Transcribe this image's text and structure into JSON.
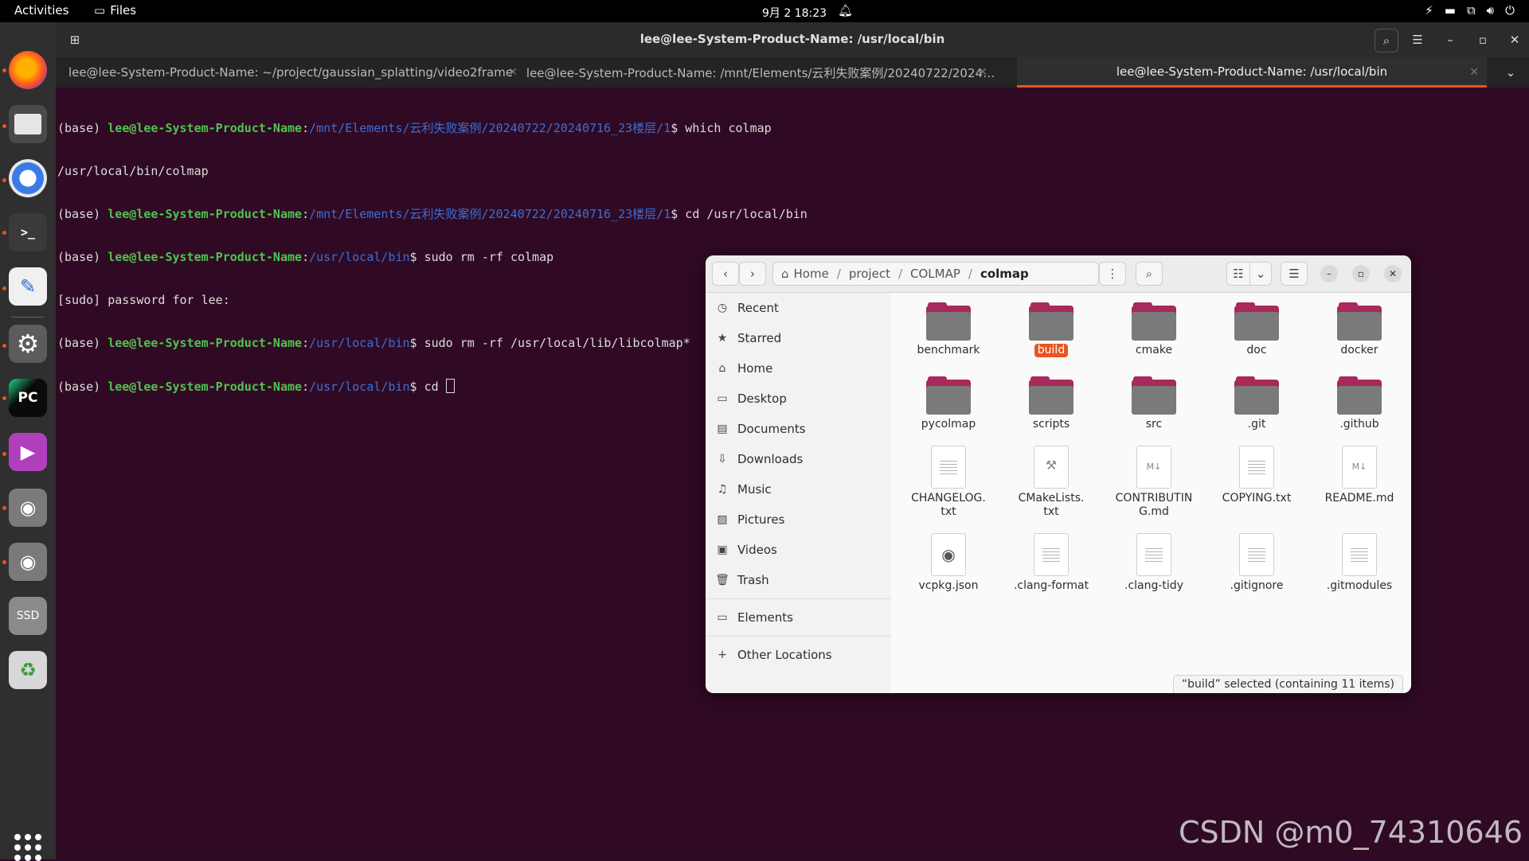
{
  "topbar": {
    "activities": "Activities",
    "app_name": "Files",
    "clock": "9月 2  18:23"
  },
  "terminal": {
    "title": "lee@lee-System-Product-Name: /usr/local/bin",
    "tabs": [
      {
        "label": "lee@lee-System-Product-Name: ~/project/gaussian_splatting/video2frame"
      },
      {
        "label": "lee@lee-System-Product-Name: /mnt/Elements/云利失败案例/20240722/2024…"
      },
      {
        "label": "lee@lee-System-Product-Name: /usr/local/bin"
      }
    ],
    "lines": [
      {
        "env": "(base) ",
        "user": "lee@lee-System-Product-Name",
        "colon": ":",
        "path": "/mnt/Elements/云利失败案例/20240722/20240716_23楼层/1",
        "cmd": "$ which colmap"
      },
      {
        "text": "/usr/local/bin/colmap"
      },
      {
        "env": "(base) ",
        "user": "lee@lee-System-Product-Name",
        "colon": ":",
        "path": "/mnt/Elements/云利失败案例/20240722/20240716_23楼层/1",
        "cmd": "$ cd /usr/local/bin"
      },
      {
        "env": "(base) ",
        "user": "lee@lee-System-Product-Name",
        "colon": ":",
        "path": "/usr/local/bin",
        "cmd": "$ sudo rm -rf colmap"
      },
      {
        "text": "[sudo] password for lee:"
      },
      {
        "env": "(base) ",
        "user": "lee@lee-System-Product-Name",
        "colon": ":",
        "path": "/usr/local/bin",
        "cmd": "$ sudo rm -rf /usr/local/lib/libcolmap*"
      },
      {
        "env": "(base) ",
        "user": "lee@lee-System-Product-Name",
        "colon": ":",
        "path": "/usr/local/bin",
        "cmd": "$ cd "
      }
    ]
  },
  "files": {
    "path": [
      "Home",
      "project",
      "COLMAP",
      "colmap"
    ],
    "sidebar": [
      {
        "label": "Recent",
        "icon": "clock-icon"
      },
      {
        "label": "Starred",
        "icon": "star-icon"
      },
      {
        "label": "Home",
        "icon": "home-icon"
      },
      {
        "label": "Desktop",
        "icon": "desktop-icon"
      },
      {
        "label": "Documents",
        "icon": "document-icon"
      },
      {
        "label": "Downloads",
        "icon": "download-icon"
      },
      {
        "label": "Music",
        "icon": "music-icon"
      },
      {
        "label": "Pictures",
        "icon": "picture-icon"
      },
      {
        "label": "Videos",
        "icon": "video-icon"
      },
      {
        "label": "Trash",
        "icon": "trash-icon"
      },
      {
        "label": "Elements",
        "icon": "folder-icon"
      },
      {
        "label": "Other Locations",
        "icon": "plus-icon"
      }
    ],
    "items": [
      {
        "name": "benchmark",
        "kind": "folder"
      },
      {
        "name": "build",
        "kind": "folder",
        "selected": true
      },
      {
        "name": "cmake",
        "kind": "folder"
      },
      {
        "name": "doc",
        "kind": "folder"
      },
      {
        "name": "docker",
        "kind": "folder"
      },
      {
        "name": "pycolmap",
        "kind": "folder"
      },
      {
        "name": "scripts",
        "kind": "folder"
      },
      {
        "name": "src",
        "kind": "folder"
      },
      {
        "name": ".git",
        "kind": "folder"
      },
      {
        "name": ".github",
        "kind": "folder"
      },
      {
        "name": "CHANGELOG.\ntxt",
        "kind": "text"
      },
      {
        "name": "CMakeLists.\ntxt",
        "kind": "cmake"
      },
      {
        "name": "CONTRIBUTIN\nG.md",
        "kind": "markdown"
      },
      {
        "name": "COPYING.txt",
        "kind": "text"
      },
      {
        "name": "README.md",
        "kind": "markdown"
      },
      {
        "name": "vcpkg.json",
        "kind": "json"
      },
      {
        "name": ".clang-format",
        "kind": "text"
      },
      {
        "name": ".clang-tidy",
        "kind": "text"
      },
      {
        "name": ".gitignore",
        "kind": "text"
      },
      {
        "name": ".gitmodules",
        "kind": "text"
      }
    ],
    "status": "“build” selected  (containing 11 items)"
  },
  "watermark": "CSDN @m0_74310646",
  "colors": {
    "accent": "#e95420",
    "terminal_bg": "#300a24",
    "folder_tab": "#a8295a"
  }
}
